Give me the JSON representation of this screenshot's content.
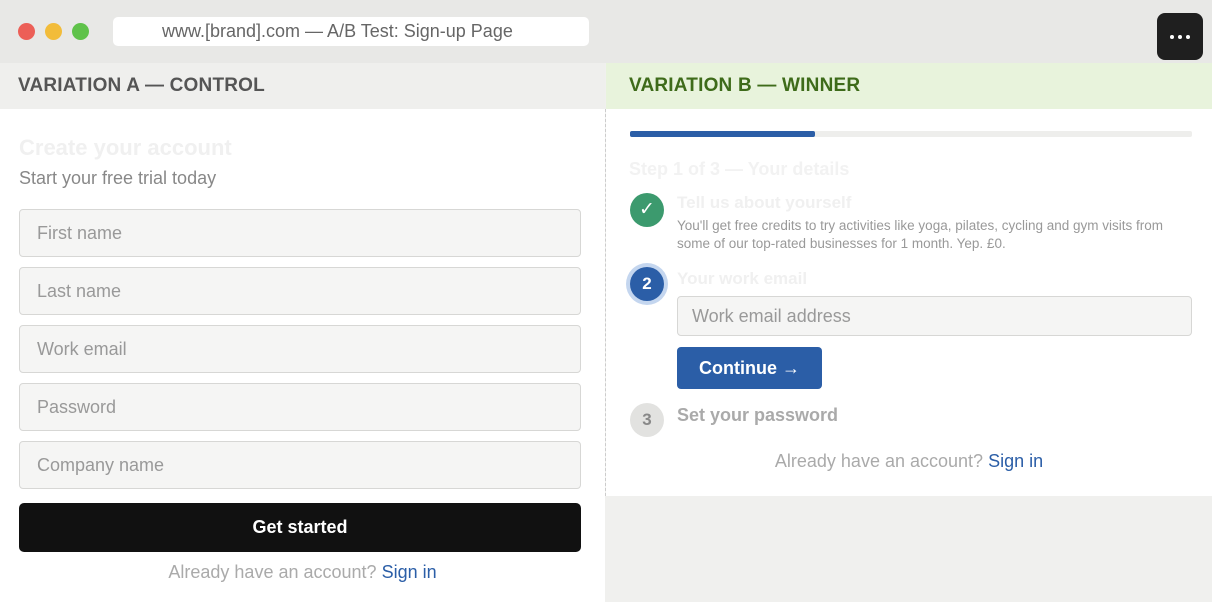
{
  "window": {
    "url_title": "www.[brand].com — A/B Test: Sign-up Page",
    "menu_icon": "more-horizontal-icon"
  },
  "variation_a": {
    "header": "VARIATION A — CONTROL",
    "title": "Create your account",
    "subtitle": "Start your free trial today",
    "fields": [
      {
        "placeholder": "First name"
      },
      {
        "placeholder": "Last name"
      },
      {
        "placeholder": "Work email"
      },
      {
        "placeholder": "Password"
      },
      {
        "placeholder": "Company name"
      }
    ],
    "submit_label": "Get started",
    "signin_prompt": "Already have an account?",
    "signin_link": "Sign in"
  },
  "variation_b": {
    "header": "VARIATION B — WINNER",
    "progress_fraction": 0.33,
    "step_label": "Step 1 of 3 — Your details",
    "steps": [
      {
        "number": "✓",
        "title": "Tell us about yourself",
        "description": "You'll get free credits to try activities like yoga, pilates, cycling and gym visits from some of our top-rated businesses for 1 month. Yep. £0.",
        "state": "done"
      },
      {
        "number": "2",
        "title": "Your work email",
        "state": "active"
      },
      {
        "number": "3",
        "title": "Set your password",
        "state": "todo"
      }
    ],
    "email_placeholder": "Work email address",
    "continue_label": "Continue →",
    "signin_prompt": "Already have an account?",
    "signin_link": "Sign in"
  },
  "colors": {
    "accent_blue": "#2b5ea7",
    "success_green": "#3c9a6e",
    "winner_header_bg": "#e8f3dc",
    "winner_header_text": "#3e6b1a",
    "primary_button": "#111111"
  }
}
